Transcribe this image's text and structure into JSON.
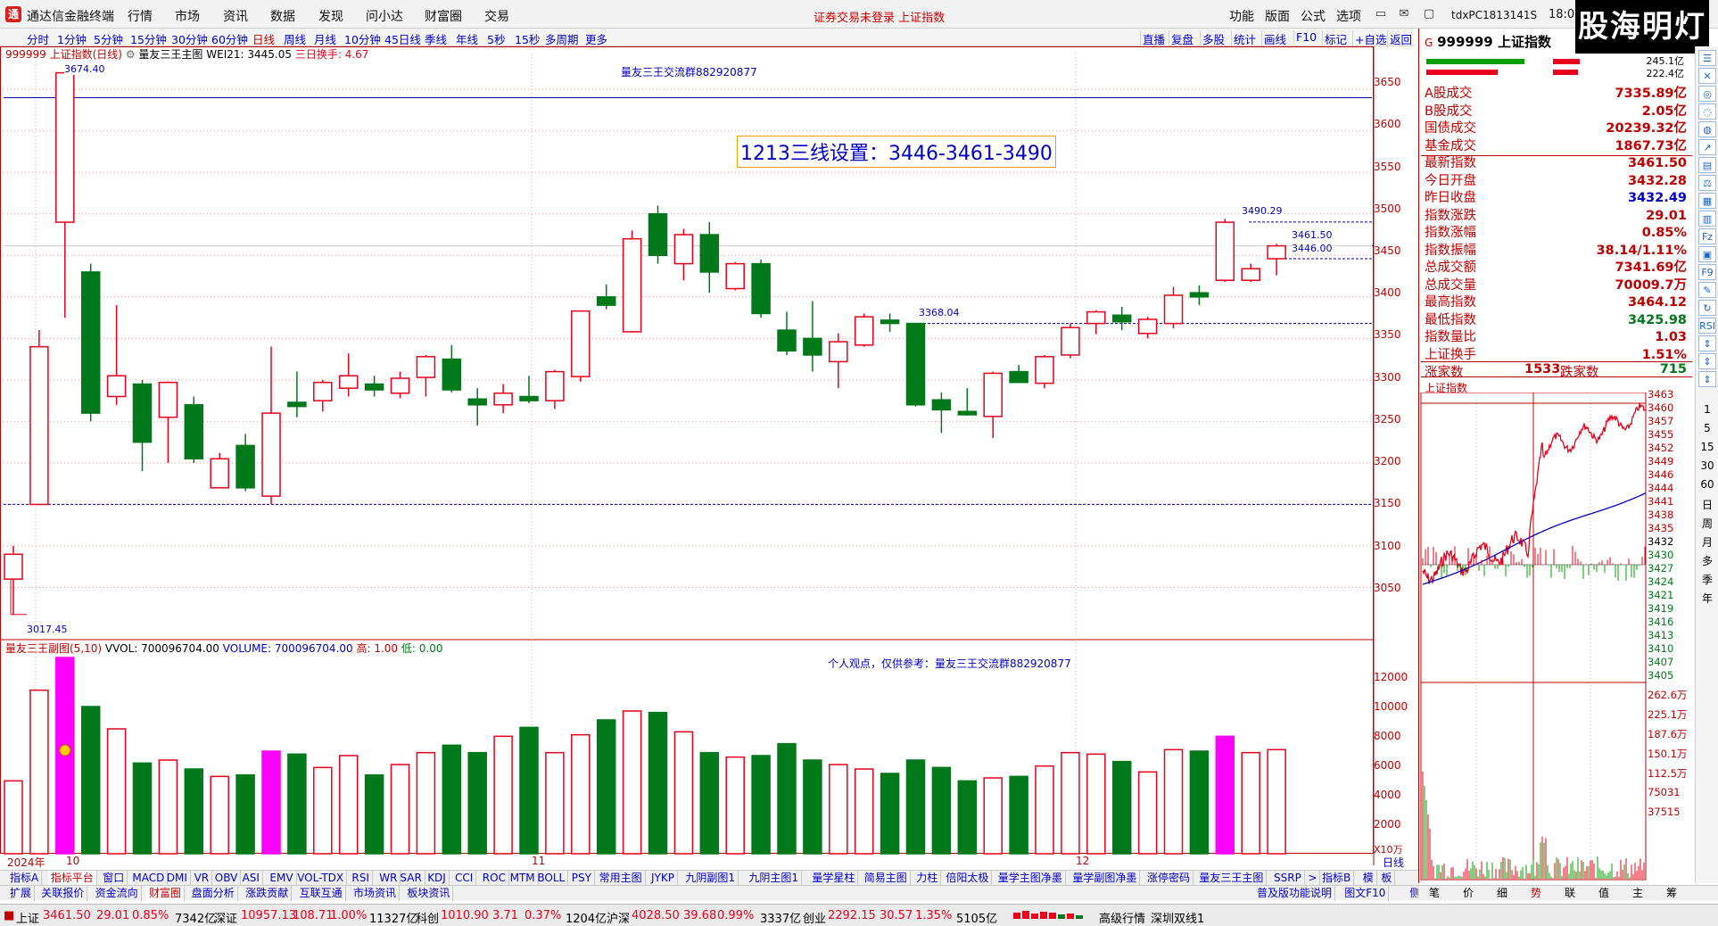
{
  "titlebar": {
    "app_name": "通达信金融终端",
    "menus": [
      "行情",
      "市场",
      "资讯",
      "数据",
      "发现",
      "问小达",
      "财富圈",
      "交易"
    ],
    "center_note": "证券交易未登录  上证指数",
    "func_menus": [
      "功能",
      "版面",
      "公式",
      "选项"
    ],
    "machine_id": "tdxPC1813141S",
    "clock": "18:0",
    "brand": "股海明灯"
  },
  "periods": [
    "分时",
    "1分钟",
    "5分钟",
    "15分钟",
    "30分钟",
    "60分钟",
    "日线",
    "周线",
    "月线",
    "10分钟",
    "45日线",
    "季线",
    "年线",
    "5秒",
    "15秒",
    "多周期",
    "更多"
  ],
  "active_period": "日线",
  "right_buttons": [
    "直播",
    "复盘",
    "多股",
    "统计",
    "画线",
    "F10",
    "标记",
    "+自选",
    "返回"
  ],
  "main_info": {
    "code": "999999 上证指数(日线)",
    "indicator": "量友三王主图",
    "wei": "WEI21: 3445.05",
    "three": "三日换手: 4.67"
  },
  "announce1": "量友三王交流群882920877",
  "threeline": "1213三线设置：3446-3461-3490",
  "price_annotations": {
    "high": "3674.40",
    "low": "3017.45",
    "p3490": "3490.29",
    "p3461": "3461.50",
    "p3446": "3446.00",
    "p3368": "3368.04"
  },
  "axis": {
    "price": [
      "3650",
      "3600",
      "3550",
      "3500",
      "3450",
      "3400",
      "3350",
      "3300",
      "3250",
      "3200",
      "3150",
      "3100",
      "3050"
    ],
    "volume": [
      "12000",
      "10000",
      "8000",
      "6000",
      "4000",
      "2000"
    ],
    "unit": "X10万",
    "xlabels": [
      "2024年",
      "10",
      "11",
      "12"
    ]
  },
  "vol_info": {
    "name": "量友三王副图(5,10)",
    "vvol": "VVOL: 700096704.00",
    "volume": "VOLUME: 700096704.00",
    "high": "高: 1.00",
    "low": "低: 0.00"
  },
  "announce2": "个人观点，仅供参考：量友三王交流群882920877",
  "chart_data": {
    "type": "candlestick",
    "title": "999999 上证指数(日线)",
    "candles": [
      {
        "o": 3060,
        "h": 3100,
        "l": 3017.45,
        "c": 3090,
        "v": 4900
      },
      {
        "o": 3150,
        "h": 3360,
        "l": 3150,
        "c": 3340,
        "v": 11000
      },
      {
        "o": 3490,
        "h": 3674.4,
        "l": 3375,
        "c": 3670,
        "v": 13200
      },
      {
        "o": 3430,
        "h": 3440,
        "l": 3250,
        "c": 3260,
        "v": 9900
      },
      {
        "o": 3280,
        "h": 3390,
        "l": 3270,
        "c": 3305,
        "v": 8400
      },
      {
        "o": 3295,
        "h": 3300,
        "l": 3190,
        "c": 3225,
        "v": 6100
      },
      {
        "o": 3255,
        "h": 3298,
        "l": 3200,
        "c": 3297,
        "v": 6300
      },
      {
        "o": 3270,
        "h": 3280,
        "l": 3200,
        "c": 3205,
        "v": 5700
      },
      {
        "o": 3170,
        "h": 3212,
        "l": 3170,
        "c": 3205,
        "v": 5200
      },
      {
        "o": 3221,
        "h": 3235,
        "l": 3166,
        "c": 3170,
        "v": 5300
      },
      {
        "o": 3160,
        "h": 3340,
        "l": 3150,
        "c": 3260,
        "v": 6900
      },
      {
        "o": 3273,
        "h": 3310,
        "l": 3255,
        "c": 3268,
        "v": 6700
      },
      {
        "o": 3275,
        "h": 3300,
        "l": 3262,
        "c": 3297,
        "v": 5800
      },
      {
        "o": 3290,
        "h": 3332,
        "l": 3280,
        "c": 3305,
        "v": 6600
      },
      {
        "o": 3295,
        "h": 3305,
        "l": 3280,
        "c": 3288,
        "v": 5300
      },
      {
        "o": 3284,
        "h": 3310,
        "l": 3278,
        "c": 3302,
        "v": 6000
      },
      {
        "o": 3303,
        "h": 3330,
        "l": 3280,
        "c": 3328,
        "v": 6800
      },
      {
        "o": 3325,
        "h": 3342,
        "l": 3285,
        "c": 3288,
        "v": 7300
      },
      {
        "o": 3277,
        "h": 3290,
        "l": 3245,
        "c": 3270,
        "v": 6800
      },
      {
        "o": 3270,
        "h": 3295,
        "l": 3260,
        "c": 3284,
        "v": 7900
      },
      {
        "o": 3280,
        "h": 3305,
        "l": 3272,
        "c": 3275,
        "v": 8500
      },
      {
        "o": 3275,
        "h": 3312,
        "l": 3265,
        "c": 3310,
        "v": 6800
      },
      {
        "o": 3304,
        "h": 3383,
        "l": 3298,
        "c": 3383,
        "v": 8000
      },
      {
        "o": 3400,
        "h": 3415,
        "l": 3385,
        "c": 3390,
        "v": 9000
      },
      {
        "o": 3358,
        "h": 3480,
        "l": 3357,
        "c": 3470,
        "v": 9600
      },
      {
        "o": 3500,
        "h": 3510,
        "l": 3440,
        "c": 3450,
        "v": 9500
      },
      {
        "o": 3440,
        "h": 3482,
        "l": 3420,
        "c": 3475,
        "v": 8200
      },
      {
        "o": 3475,
        "h": 3490,
        "l": 3405,
        "c": 3430,
        "v": 6800
      },
      {
        "o": 3410,
        "h": 3442,
        "l": 3408,
        "c": 3440,
        "v": 6500
      },
      {
        "o": 3440,
        "h": 3445,
        "l": 3375,
        "c": 3380,
        "v": 6600
      },
      {
        "o": 3360,
        "h": 3382,
        "l": 3330,
        "c": 3335,
        "v": 7400
      },
      {
        "o": 3350,
        "h": 3395,
        "l": 3310,
        "c": 3330,
        "v": 6300
      },
      {
        "o": 3322,
        "h": 3356,
        "l": 3290,
        "c": 3346,
        "v": 6000
      },
      {
        "o": 3342,
        "h": 3380,
        "l": 3340,
        "c": 3376,
        "v": 5700
      },
      {
        "o": 3372,
        "h": 3380,
        "l": 3358,
        "c": 3368,
        "v": 5400
      },
      {
        "o": 3368.04,
        "h": 3368.04,
        "l": 3268,
        "c": 3270,
        "v": 6300
      },
      {
        "o": 3276,
        "h": 3285,
        "l": 3236,
        "c": 3264,
        "v": 5800
      },
      {
        "o": 3262,
        "h": 3290,
        "l": 3257,
        "c": 3258,
        "v": 4900
      },
      {
        "o": 3256,
        "h": 3310,
        "l": 3230,
        "c": 3308,
        "v": 5100
      },
      {
        "o": 3310,
        "h": 3318,
        "l": 3297,
        "c": 3297,
        "v": 5200
      },
      {
        "o": 3296,
        "h": 3330,
        "l": 3290,
        "c": 3328,
        "v": 5900
      },
      {
        "o": 3330,
        "h": 3368,
        "l": 3326,
        "c": 3363,
        "v": 6800
      },
      {
        "o": 3368,
        "h": 3384,
        "l": 3355,
        "c": 3382,
        "v": 6700
      },
      {
        "o": 3378,
        "h": 3388,
        "l": 3360,
        "c": 3370,
        "v": 6200
      },
      {
        "o": 3356,
        "h": 3376,
        "l": 3350,
        "c": 3373,
        "v": 5500
      },
      {
        "o": 3368,
        "h": 3412,
        "l": 3362,
        "c": 3402,
        "v": 7000
      },
      {
        "o": 3405,
        "h": 3414,
        "l": 3390,
        "c": 3400,
        "v": 6900
      },
      {
        "o": 3420,
        "h": 3494,
        "l": 3418,
        "c": 3490,
        "v": 7900
      },
      {
        "o": 3420,
        "h": 3440,
        "l": 3418,
        "c": 3434,
        "v": 6800
      },
      {
        "o": 3446,
        "h": 3464,
        "l": 3426,
        "c": 3461.5,
        "v": 7000
      }
    ],
    "price_range": [
      3000,
      3690
    ],
    "volume_range": [
      0,
      13500
    ],
    "hlines": [
      3640,
      3461.5,
      3446,
      3490.29,
      3368.04,
      3150
    ]
  },
  "right_panel": {
    "code": "999999 上证指数",
    "g": "G",
    "head_vals": [
      "245.1亿",
      "222.4亿"
    ],
    "rows": [
      [
        "A股成交",
        "7335.89亿"
      ],
      [
        "B股成交",
        "2.05亿"
      ],
      [
        "国债成交",
        "20239.32亿"
      ],
      [
        "基金成交",
        "1867.73亿"
      ],
      [
        "最新指数",
        "3461.50"
      ],
      [
        "今日开盘",
        "3432.28"
      ],
      [
        "昨日收盘",
        "3432.49"
      ],
      [
        "指数涨跌",
        "29.01"
      ],
      [
        "指数涨幅",
        "0.85%"
      ],
      [
        "指数振幅",
        "38.14/1.11%"
      ],
      [
        "总成交额",
        "7341.69亿"
      ],
      [
        "总成交量",
        "70009.7万"
      ],
      [
        "最高指数",
        "3464.12"
      ],
      [
        "最低指数",
        "3425.98"
      ],
      [
        "指数量比",
        "1.03"
      ],
      [
        "上证换手",
        "1.51%"
      ]
    ],
    "updown": {
      "up_label": "涨家数",
      "up": "1533",
      "down_label": "跌家数",
      "down": "715"
    },
    "mini_title": "上证指数",
    "mini_yaxis": [
      "3463",
      "3460",
      "3457",
      "3455",
      "3452",
      "3449",
      "3446",
      "3444",
      "3441",
      "3438",
      "3435",
      "3432",
      "3430",
      "3427",
      "3424",
      "3421",
      "3419",
      "3416",
      "3413",
      "3410",
      "3407",
      "3405"
    ],
    "mini_vol": [
      "262.6万",
      "225.1万",
      "187.6万",
      "150.1万",
      "112.5万",
      "75031",
      "37515"
    ]
  },
  "sidebar": {
    "icons": [
      "☰",
      "✕",
      "◎",
      "◌",
      "◍",
      "↗",
      "▤",
      "⚖",
      "▦",
      "▥",
      "Fz",
      "▣",
      "F9",
      "✎",
      "↻",
      "RSI",
      "⇕",
      "⇕",
      "⇕"
    ],
    "periods": [
      "1",
      "5",
      "15",
      "30",
      "60",
      "日",
      "周",
      "月",
      "多",
      "季",
      "年"
    ]
  },
  "tabs1": [
    "指标A",
    "指标平台",
    "窗口",
    "MACD",
    "DMI",
    "VR",
    "OBV",
    "ASI",
    "EMV",
    "VOL-TDX",
    "RSI",
    "WR",
    "SAR",
    "KDJ",
    "CCI",
    "ROC",
    "MTM",
    "BOLL",
    "PSY",
    "常用主图",
    "JYKP",
    "九阴副图1",
    "九阴主图1",
    "量学星柱",
    "简易主图",
    "力柱",
    "倍阳太极",
    "量学主图净墨",
    "量学副图净墨",
    "涨停密码",
    "量友三王主图",
    "SSRP",
    ">",
    "指标B",
    "模",
    "板"
  ],
  "tabs2": [
    "扩展",
    "关联报价",
    "资金流向",
    "财富圈",
    "盘面分析",
    "涨跌贡献",
    "互联互通",
    "市场资讯",
    "板块资讯",
    "普及版功能说明",
    "图文F10",
    "侧边栏"
  ],
  "rtabs": [
    "笔",
    "价",
    "细",
    "势",
    "联",
    "值",
    "主",
    "筹"
  ],
  "statusbar": {
    "sh_name": "上证",
    "sh_val": "3461.50",
    "sh_chg": "29.01",
    "sh_pct": "0.85%",
    "sh_amt": "7342亿",
    "sz_name": "深证",
    "sz_val": "10957.13",
    "sz_chg": "108.71",
    "sz_pct": "1.00%",
    "sz_amt": "11327亿",
    "kc_name": "科创",
    "kc_val": "1010.90",
    "kc_chg": "3.71",
    "kc_pct": "0.37%",
    "kc_amt": "1204亿",
    "hs_name": "沪深",
    "hs_val": "4028.50",
    "hs_chg": "39.68",
    "hs_pct": "0.99%",
    "hs_amt": "3337亿",
    "cy_name": "创业",
    "cy_val": "2292.15",
    "cy_chg": "30.57",
    "cy_pct": "1.35%",
    "cy_amt": "5105亿",
    "quote": "高级行情",
    "dual": "深圳双线1"
  },
  "colors": {
    "up": "#e8001c",
    "down": "#00791a",
    "mag": "#ff00ff",
    "blue": "#0000c8"
  }
}
